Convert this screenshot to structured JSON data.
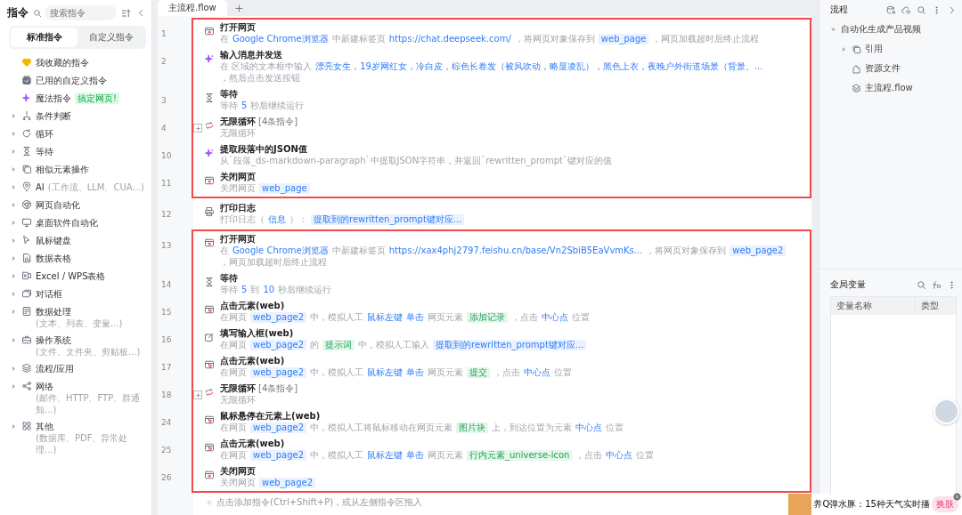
{
  "sidebar": {
    "title": "指令",
    "search": {
      "placeholder": "搜索指令"
    },
    "tabs": [
      {
        "label": "标准指令",
        "selected": true
      },
      {
        "label": "自定义指令",
        "selected": false
      }
    ],
    "items": [
      {
        "kind": "favorites",
        "label": "我收藏的指令"
      },
      {
        "kind": "custom",
        "label": "已用的自定义指令"
      },
      {
        "kind": "magic",
        "label": "魔法指令",
        "badge": "搞定网页!"
      },
      {
        "kind": "condition",
        "label": "条件判断",
        "expanded": false
      },
      {
        "kind": "loop",
        "label": "循环",
        "expanded": false
      },
      {
        "kind": "wait",
        "label": "等待",
        "expanded": false
      },
      {
        "kind": "similar",
        "label": "相似元素操作",
        "expanded": false
      },
      {
        "kind": "ai",
        "label": "AI",
        "hint": "(工作流、LLM、CUA...)",
        "expanded": false
      },
      {
        "kind": "web",
        "label": "网页自动化",
        "expanded": false
      },
      {
        "kind": "desktop",
        "label": "桌面软件自动化",
        "expanded": false
      },
      {
        "kind": "mouse",
        "label": "鼠标键盘",
        "expanded": false
      },
      {
        "kind": "sheet",
        "label": "数据表格",
        "expanded": false
      },
      {
        "kind": "excel",
        "label": "Excel / WPS表格",
        "expanded": false
      },
      {
        "kind": "dialog",
        "label": "对话框",
        "expanded": false
      },
      {
        "kind": "data",
        "label": "数据处理",
        "hint": "(文本、列表、变量...)",
        "expanded": false
      },
      {
        "kind": "os",
        "label": "操作系统",
        "hint": "(文件、文件夹、剪贴板...)",
        "expanded": false
      },
      {
        "kind": "flow",
        "label": "流程/应用",
        "expanded": false
      },
      {
        "kind": "network",
        "label": "网络",
        "hint": "(邮件、HTTP、FTP、群通知...)",
        "expanded": false
      },
      {
        "kind": "other",
        "label": "其他",
        "hint": "(数据库、PDF、异常处理...)",
        "expanded": false
      }
    ]
  },
  "editor": {
    "tabs": [
      {
        "label": "主流程.flow",
        "selected": true
      }
    ],
    "groups": [
      {
        "highlighted": true,
        "steps": [
          {
            "line": "1",
            "kind": "browser",
            "title": "打开网页",
            "desc": [
              {
                "text": "在",
                "kind": "plain"
              },
              {
                "text": "Google Chrome浏览器",
                "kind": "link"
              },
              {
                "text": "中新建标签页",
                "kind": "plain"
              },
              {
                "text": "https://chat.deepseek.com/",
                "kind": "link"
              },
              {
                "text": "，将网页对象保存到",
                "kind": "plain"
              },
              {
                "text": "web_page",
                "kind": "var"
              },
              {
                "text": "，网页加载超时后终止流程",
                "kind": "plain"
              }
            ]
          },
          {
            "line": "2",
            "kind": "ai",
            "title": "输入消息并发送",
            "desc": [
              {
                "text": "在 区域的文本框中输入",
                "kind": "plain"
              },
              {
                "text": "漂亮女生，19岁网红女，冷白皮，棕色长卷发（被风吹动，略显凌乱），黑色上衣，夜晚户外街道场景（背景、...",
                "kind": "link"
              },
              {
                "text": "，然后点击发送按钮",
                "kind": "plain"
              }
            ]
          },
          {
            "line": "3",
            "kind": "wait",
            "title": "等待",
            "desc": [
              {
                "text": "等待",
                "kind": "plain"
              },
              {
                "text": "5",
                "kind": "link"
              },
              {
                "text": "秒后继续运行",
                "kind": "plain"
              }
            ]
          },
          {
            "line": "4",
            "kind": "loop",
            "title": "无限循环",
            "suffix": "[4条指令]",
            "folded": true,
            "desc": [
              {
                "text": "无限循环",
                "kind": "plain"
              }
            ]
          },
          {
            "line": "10",
            "kind": "ai",
            "title": "提取段落中的JSON值",
            "desc": [
              {
                "text": "从`段落_ds-markdown-paragraph`中提取JSON字符串，并返回`rewritten_prompt`键对应的值",
                "kind": "plain"
              }
            ]
          },
          {
            "line": "11",
            "kind": "browser",
            "title": "关闭网页",
            "desc": [
              {
                "text": "关闭网页",
                "kind": "plain"
              },
              {
                "text": "web_page",
                "kind": "var"
              }
            ]
          }
        ]
      },
      {
        "highlighted": false,
        "steps": [
          {
            "line": "12",
            "kind": "log",
            "title": "打印日志",
            "desc": [
              {
                "text": "打印日志（",
                "kind": "plain"
              },
              {
                "text": "信息",
                "kind": "link"
              },
              {
                "text": "）：",
                "kind": "plain"
              },
              {
                "text": "提取到的rewritten_prompt键对应...",
                "kind": "var"
              }
            ]
          }
        ]
      },
      {
        "highlighted": true,
        "steps": [
          {
            "line": "13",
            "kind": "browser",
            "title": "打开网页",
            "desc": [
              {
                "text": "在",
                "kind": "plain"
              },
              {
                "text": "Google Chrome浏览器",
                "kind": "link"
              },
              {
                "text": "中新建标签页",
                "kind": "plain"
              },
              {
                "text": "https://xax4phj2797.feishu.cn/base/Vn2SbiB5EaVvmKs...",
                "kind": "link"
              },
              {
                "text": "，将网页对象保存到",
                "kind": "plain"
              },
              {
                "text": "web_page2",
                "kind": "var"
              },
              {
                "text": "，网页加载超时后终止流程",
                "kind": "plain"
              }
            ]
          },
          {
            "line": "14",
            "kind": "wait",
            "title": "等待",
            "desc": [
              {
                "text": "等待",
                "kind": "plain"
              },
              {
                "text": "5",
                "kind": "link"
              },
              {
                "text": "到",
                "kind": "plain"
              },
              {
                "text": "10",
                "kind": "link"
              },
              {
                "text": "秒后继续运行",
                "kind": "plain"
              }
            ]
          },
          {
            "line": "15",
            "kind": "click",
            "title": "点击元素(web)",
            "desc": [
              {
                "text": "在网页",
                "kind": "plain"
              },
              {
                "text": "web_page2",
                "kind": "var"
              },
              {
                "text": "中，模拟人工",
                "kind": "plain"
              },
              {
                "text": "鼠标左键",
                "kind": "link"
              },
              {
                "text": "单击",
                "kind": "link"
              },
              {
                "text": "网页元素",
                "kind": "plain"
              },
              {
                "text": "添加记录",
                "kind": "elem"
              },
              {
                "text": "，点击",
                "kind": "plain"
              },
              {
                "text": "中心点",
                "kind": "link"
              },
              {
                "text": "位置",
                "kind": "plain"
              }
            ]
          },
          {
            "line": "16",
            "kind": "input",
            "title": "填写输入框(web)",
            "desc": [
              {
                "text": "在网页",
                "kind": "plain"
              },
              {
                "text": "web_page2",
                "kind": "var"
              },
              {
                "text": "的",
                "kind": "plain"
              },
              {
                "text": "提示词",
                "kind": "elem"
              },
              {
                "text": "中，模拟人工输入",
                "kind": "plain"
              },
              {
                "text": "提取到的rewritten_prompt键对应...",
                "kind": "var"
              }
            ]
          },
          {
            "line": "17",
            "kind": "click",
            "title": "点击元素(web)",
            "desc": [
              {
                "text": "在网页",
                "kind": "plain"
              },
              {
                "text": "web_page2",
                "kind": "var"
              },
              {
                "text": "中，模拟人工",
                "kind": "plain"
              },
              {
                "text": "鼠标左键",
                "kind": "link"
              },
              {
                "text": "单击",
                "kind": "link"
              },
              {
                "text": "网页元素",
                "kind": "plain"
              },
              {
                "text": "提交",
                "kind": "elem"
              },
              {
                "text": "，点击",
                "kind": "plain"
              },
              {
                "text": "中心点",
                "kind": "link"
              },
              {
                "text": "位置",
                "kind": "plain"
              }
            ]
          },
          {
            "line": "18",
            "kind": "loop",
            "title": "无限循环",
            "suffix": "[4条指令]",
            "folded": true,
            "desc": [
              {
                "text": "无限循环",
                "kind": "plain"
              }
            ]
          },
          {
            "line": "24",
            "kind": "click",
            "title": "鼠标悬停在元素上(web)",
            "desc": [
              {
                "text": "在网页",
                "kind": "plain"
              },
              {
                "text": "web_page2",
                "kind": "var"
              },
              {
                "text": "中，模拟人工将鼠标移动在网页元素",
                "kind": "plain"
              },
              {
                "text": "图片块",
                "kind": "elem"
              },
              {
                "text": "上，到达位置为元素",
                "kind": "plain"
              },
              {
                "text": "中心点",
                "kind": "link"
              },
              {
                "text": "位置",
                "kind": "plain"
              }
            ]
          },
          {
            "line": "25",
            "kind": "click",
            "title": "点击元素(web)",
            "desc": [
              {
                "text": "在网页",
                "kind": "plain"
              },
              {
                "text": "web_page2",
                "kind": "var"
              },
              {
                "text": "中，模拟人工",
                "kind": "plain"
              },
              {
                "text": "鼠标左键",
                "kind": "link"
              },
              {
                "text": "单击",
                "kind": "link"
              },
              {
                "text": "网页元素",
                "kind": "plain"
              },
              {
                "text": "行内元素_universe-icon",
                "kind": "elem"
              },
              {
                "text": "，点击",
                "kind": "plain"
              },
              {
                "text": "中心点",
                "kind": "link"
              },
              {
                "text": "位置",
                "kind": "plain"
              }
            ]
          },
          {
            "line": "26",
            "kind": "browser",
            "title": "关闭网页",
            "desc": [
              {
                "text": "关闭网页",
                "kind": "plain"
              },
              {
                "text": "web_page2",
                "kind": "var"
              }
            ]
          }
        ]
      }
    ],
    "add_hint": "点击添加指令(Ctrl+Shift+P)，或从左侧指令区拖入"
  },
  "flow_panel": {
    "title": "流程",
    "tree": [
      {
        "label": "自动化生成产品视频",
        "expanded": true,
        "children": [
          {
            "label": "引用",
            "kind": "ref",
            "expanded": false
          },
          {
            "label": "资源文件",
            "kind": "res"
          },
          {
            "label": "主流程.flow",
            "kind": "flow"
          }
        ]
      }
    ]
  },
  "variables_panel": {
    "title": "全局变量",
    "columns": [
      "变量名称",
      "类型"
    ]
  },
  "widget": {
    "text": "养Q弹水豚：15种天气实时播",
    "button": "换肤"
  }
}
